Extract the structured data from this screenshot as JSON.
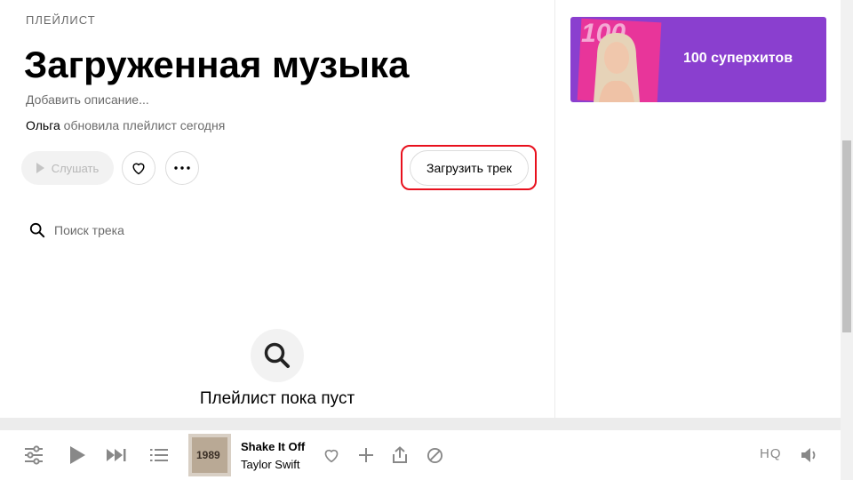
{
  "playlist": {
    "type_label": "ПЛЕЙЛИСТ",
    "title": "Загруженная музыка",
    "description_placeholder": "Добавить описание...",
    "owner": "Ольга",
    "updated_text": "обновила плейлист сегодня"
  },
  "actions": {
    "play_label": "Слушать",
    "upload_label": "Загрузить трек"
  },
  "search": {
    "placeholder": "Поиск трека"
  },
  "empty_state": {
    "text": "Плейлист пока пуст"
  },
  "promo": {
    "cover_number": "100",
    "title": "100 суперхитов"
  },
  "player": {
    "track_title": "Shake It Off",
    "artist": "Taylor Swift",
    "album_cover_text": "1989",
    "quality_label": "HQ"
  },
  "colors": {
    "highlight": "#e8101d",
    "promo_bg": "#8a3fcf",
    "icon_gray": "#888888"
  }
}
